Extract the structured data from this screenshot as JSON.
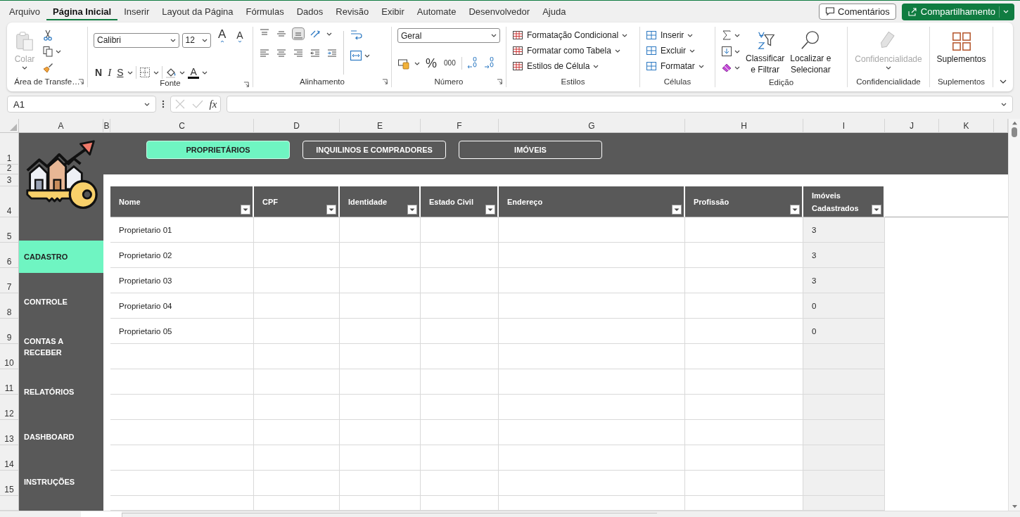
{
  "menu": [
    {
      "label": "Arquivo",
      "selected": false
    },
    {
      "label": "Página Inicial",
      "selected": true
    },
    {
      "label": "Inserir",
      "selected": false
    },
    {
      "label": "Layout da Página",
      "selected": false
    },
    {
      "label": "Fórmulas",
      "selected": false
    },
    {
      "label": "Dados",
      "selected": false
    },
    {
      "label": "Revisão",
      "selected": false
    },
    {
      "label": "Exibir",
      "selected": false
    },
    {
      "label": "Automate",
      "selected": false
    },
    {
      "label": "Desenvolvedor",
      "selected": false
    },
    {
      "label": "Ajuda",
      "selected": false
    }
  ],
  "comments_button": "Comentários",
  "share_button": "Compartilhamento",
  "ribbon": {
    "clipboard": {
      "paste": "Colar",
      "paste_disabled": true,
      "label": "Área de Transfe…"
    },
    "font": {
      "family": "Calibri",
      "size": "12",
      "grow": "A",
      "shrink": "A",
      "bold": "N",
      "italic": "I",
      "underline": "S",
      "color_letter": "A",
      "label": "Fonte"
    },
    "alignment": {
      "label": "Alinhamento"
    },
    "number": {
      "format": "Geral",
      "percent": "%",
      "thousands": "000",
      "label": "Número"
    },
    "styles": {
      "items": [
        "Formatação Condicional",
        "Formatar como Tabela",
        "Estilos de Célula"
      ],
      "label": "Estilos"
    },
    "cells": {
      "items": [
        "Inserir",
        "Excluir",
        "Formatar"
      ],
      "label": "Células"
    },
    "editing": {
      "sort": [
        "Classificar",
        "e Filtrar"
      ],
      "find": [
        "Localizar e",
        "Selecionar"
      ],
      "label": "Edição"
    },
    "sensitivity": {
      "button": "Confidencialidade",
      "disabled": true,
      "label": "Confidencialidade"
    },
    "addins": {
      "button": "Suplementos",
      "label": "Suplementos"
    }
  },
  "name_box": "A1",
  "fx": "fx",
  "column_headers": [
    "A",
    "B",
    "C",
    "D",
    "E",
    "F",
    "G",
    "H",
    "I",
    "J",
    "K"
  ],
  "row_headers": [
    "1",
    "2",
    "3",
    "4",
    "5",
    "6",
    "7",
    "8",
    "9",
    "10",
    "11",
    "12",
    "13",
    "14",
    "15"
  ],
  "nav_buttons": [
    {
      "label": "PROPRIETÁRIOS",
      "selected": true
    },
    {
      "label": "INQUILINOS E COMPRADORES",
      "selected": false
    },
    {
      "label": "IMÓVEIS",
      "selected": false
    }
  ],
  "sidebar": [
    {
      "label": "CADASTRO",
      "selected": true
    },
    {
      "label": "CONTROLE",
      "selected": false
    },
    {
      "label": "CONTAS A RECEBER",
      "selected": false
    },
    {
      "label": "RELATÓRIOS",
      "selected": false
    },
    {
      "label": "DASHBOARD",
      "selected": false
    },
    {
      "label": "INSTRUÇÕES",
      "selected": false
    }
  ],
  "table": {
    "columns": [
      "Nome",
      "CPF",
      "Identidade",
      "Estado Civil",
      "Endereço",
      "Profissão",
      "Imóveis Cadastrados"
    ],
    "rows": [
      {
        "nome": "Proprietario 01",
        "imoveis_cadastrados": "3"
      },
      {
        "nome": "Proprietario 02",
        "imoveis_cadastrados": "3"
      },
      {
        "nome": "Proprietario 03",
        "imoveis_cadastrados": "3"
      },
      {
        "nome": "Proprietario 04",
        "imoveis_cadastrados": "0"
      },
      {
        "nome": "Proprietario 05",
        "imoveis_cadastrados": "0"
      }
    ]
  }
}
